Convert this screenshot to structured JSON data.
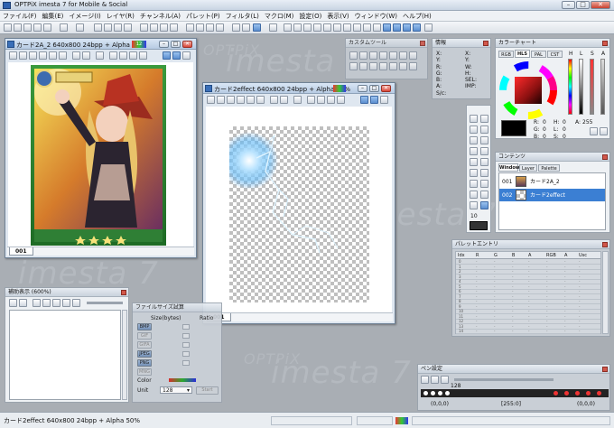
{
  "app": {
    "title": "OPTPiX imesta 7 for Mobile & Social",
    "min": "–",
    "max": "□",
    "close": "✕"
  },
  "menu": [
    "ファイル(F)",
    "編集(E)",
    "イメージ(I)",
    "レイヤ(R)",
    "チャンネル(A)",
    "パレット(P)",
    "フィルタ(L)",
    "マクロ(M)",
    "設定(O)",
    "表示(V)",
    "ウィンドウ(W)",
    "ヘルプ(H)"
  ],
  "watermarks": {
    "brand": "OPTPiX",
    "product": "imesta",
    "version": "7"
  },
  "doc1": {
    "title": "カード2A_2  640x800  24bpp + Alpha  50%",
    "tab": "001",
    "badge": "12"
  },
  "doc2": {
    "title": "カード2effect  640x800  24bpp + Alpha  50%",
    "tab": "001"
  },
  "custom_tool": {
    "title": "カスタムツール"
  },
  "info": {
    "title": "情報",
    "left": [
      "X:",
      "Y:",
      "R:",
      "G:",
      "B:",
      "A:",
      "I:",
      "S/c:"
    ],
    "right": [
      "X:",
      "Y:",
      "W:",
      "H:",
      "SEL:",
      "IMP:"
    ]
  },
  "color_chart": {
    "title": "カラーチャート",
    "tabs": [
      "RGB",
      "HLS",
      "PAL",
      "CST"
    ],
    "active_tab": "HLS",
    "slider_labels": [
      "H",
      "L",
      "S",
      "A"
    ],
    "values": {
      "r_label": "R:",
      "r": "0",
      "g_label": "G:",
      "g": "0",
      "b_label": "B:",
      "b": "0",
      "h_label": "H:",
      "h": "0",
      "l_label": "L:",
      "l": "0",
      "s_label": "S:",
      "s": "0",
      "a_label": "A:",
      "a": "255"
    },
    "fg_color": "#000000",
    "bg_color": "#ffffff"
  },
  "contents": {
    "title": "コンテンツ",
    "tabs": [
      "Window",
      "Layer",
      "Palette"
    ],
    "active_tab": "Window",
    "items": [
      {
        "num": "001",
        "name": "カード2A_2"
      },
      {
        "num": "002",
        "name": "カード2effect"
      }
    ]
  },
  "tool_value": "10",
  "palette_entry": {
    "title": "パレットエントリ",
    "headers": [
      "Idx",
      "R",
      "G",
      "B",
      "A",
      "RGB",
      "A",
      "Usc"
    ],
    "rows": [
      "0",
      "1",
      "2",
      "3",
      "4",
      "5",
      "6",
      "7",
      "8",
      "9",
      "10",
      "11",
      "12",
      "13",
      "14"
    ],
    "empty": "-"
  },
  "nav": {
    "title": "補助表示 (600%)"
  },
  "file_size": {
    "title": "ファイルサイズ試算",
    "col_size": "Size(bytes)",
    "col_ratio": "Ratio",
    "formats": [
      {
        "name": "BMP",
        "enabled": true
      },
      {
        "name": "GIF",
        "enabled": false
      },
      {
        "name": "GIFA",
        "enabled": false
      },
      {
        "name": "JPEG",
        "enabled": true
      },
      {
        "name": "PNG",
        "enabled": true
      },
      {
        "name": "MNG",
        "enabled": false
      }
    ],
    "color_label": "Color",
    "unit_label": "Unit",
    "unit_value": "128",
    "start": "Start"
  },
  "pen": {
    "title": "ペン設定",
    "size": "128",
    "coord_left": "(0,0,0)",
    "coord_mid": "[255:0]",
    "coord_right": "(0,0,0)"
  },
  "status": {
    "text": "カード2effect  640x800  24bpp + Alpha  50%"
  }
}
